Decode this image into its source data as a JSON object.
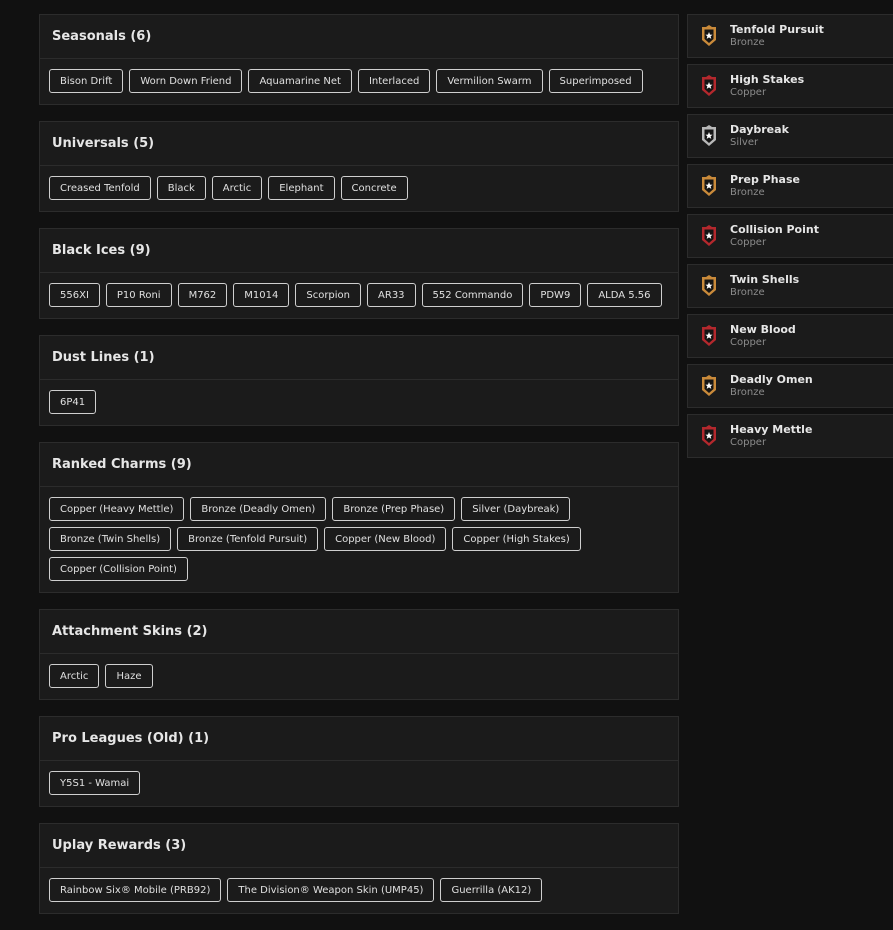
{
  "sections": [
    {
      "title": "Seasonals (6)",
      "items": [
        "Bison Drift",
        "Worn Down Friend",
        "Aquamarine Net",
        "Interlaced",
        "Vermilion Swarm",
        "Superimposed"
      ]
    },
    {
      "title": "Universals (5)",
      "items": [
        "Creased Tenfold",
        "Black",
        "Arctic",
        "Elephant",
        "Concrete"
      ]
    },
    {
      "title": "Black Ices (9)",
      "items": [
        "556XI",
        "P10 Roni",
        "M762",
        "M1014",
        "Scorpion",
        "AR33",
        "552 Commando",
        "PDW9",
        "ALDA 5.56"
      ]
    },
    {
      "title": "Dust Lines (1)",
      "items": [
        "6P41"
      ]
    },
    {
      "title": "Ranked Charms (9)",
      "items": [
        "Copper (Heavy Mettle)",
        "Bronze (Deadly Omen)",
        "Bronze (Prep Phase)",
        "Silver (Daybreak)",
        "Bronze (Twin Shells)",
        "Bronze (Tenfold Pursuit)",
        "Copper (New Blood)",
        "Copper (High Stakes)",
        "Copper (Collision Point)"
      ]
    },
    {
      "title": "Attachment Skins (2)",
      "items": [
        "Arctic",
        "Haze"
      ]
    },
    {
      "title": "Pro Leagues (Old) (1)",
      "items": [
        "Y5S1 - Wamai"
      ]
    },
    {
      "title": "Uplay Rewards (3)",
      "items": [
        "Rainbow Six® Mobile (PRB92)",
        "The Division® Weapon Skin (UMP45)",
        "Guerrilla (AK12)"
      ]
    }
  ],
  "badges": [
    {
      "name": "Tenfold Pursuit",
      "tier": "Bronze",
      "icon": "rank-bronze-icon",
      "color": "#c98a3a"
    },
    {
      "name": "High Stakes",
      "tier": "Copper",
      "icon": "rank-copper-icon",
      "color": "#b3282d"
    },
    {
      "name": "Daybreak",
      "tier": "Silver",
      "icon": "rank-silver-icon",
      "color": "#b8b8b8"
    },
    {
      "name": "Prep Phase",
      "tier": "Bronze",
      "icon": "rank-bronze-icon",
      "color": "#c98a3a"
    },
    {
      "name": "Collision Point",
      "tier": "Copper",
      "icon": "rank-copper-icon",
      "color": "#b3282d"
    },
    {
      "name": "Twin Shells",
      "tier": "Bronze",
      "icon": "rank-bronze-icon",
      "color": "#c98a3a"
    },
    {
      "name": "New Blood",
      "tier": "Copper",
      "icon": "rank-copper-icon",
      "color": "#b3282d"
    },
    {
      "name": "Deadly Omen",
      "tier": "Bronze",
      "icon": "rank-bronze-icon",
      "color": "#c98a3a"
    },
    {
      "name": "Heavy Mettle",
      "tier": "Copper",
      "icon": "rank-copper-icon",
      "color": "#b3282d"
    }
  ]
}
